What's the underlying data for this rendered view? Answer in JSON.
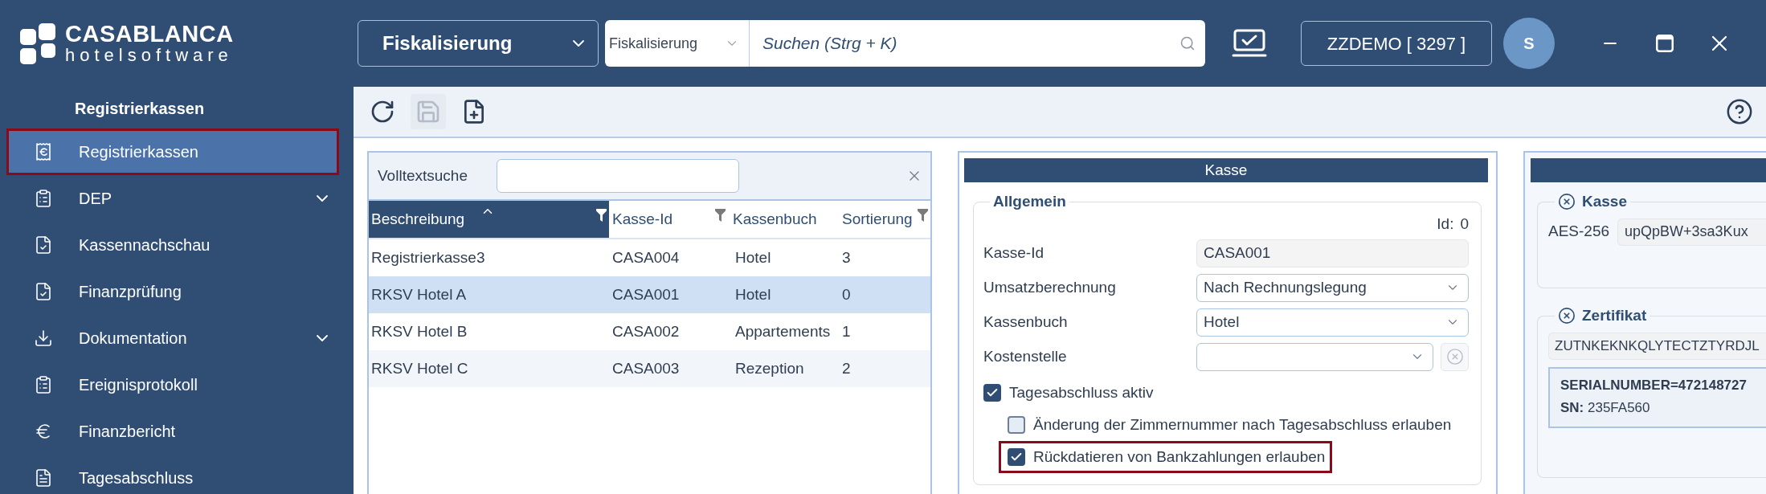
{
  "logo": {
    "name": "CASABLANCA",
    "tagline": "hotelsoftware"
  },
  "sidebar": {
    "heading": "Registrierkassen",
    "items": [
      {
        "label": "Registrierkassen",
        "selected": true,
        "highlighted": true,
        "expandable": false
      },
      {
        "label": "DEP",
        "selected": false,
        "highlighted": false,
        "expandable": true
      },
      {
        "label": "Kassennachschau",
        "selected": false,
        "highlighted": false,
        "expandable": false
      },
      {
        "label": "Finanzprüfung",
        "selected": false,
        "highlighted": false,
        "expandable": false
      },
      {
        "label": "Dokumentation",
        "selected": false,
        "highlighted": false,
        "expandable": true
      },
      {
        "label": "Ereignisprotokoll",
        "selected": false,
        "highlighted": false,
        "expandable": false
      },
      {
        "label": "Finanzbericht",
        "selected": false,
        "highlighted": false,
        "expandable": false
      },
      {
        "label": "Tagesabschluss",
        "selected": false,
        "highlighted": false,
        "expandable": false
      }
    ]
  },
  "top_bar": {
    "module": "Fiskalisierung",
    "search": {
      "scope": "Fiskalisierung",
      "placeholder": "Suchen (Strg + K)"
    },
    "client": "ZZDEMO [ 3297 ]",
    "avatar": "S"
  },
  "toolbar": {
    "buttons": [
      {
        "disabled": false
      },
      {
        "disabled": true
      },
      {
        "disabled": false
      }
    ]
  },
  "list_panel": {
    "search_label": "Volltextsuche",
    "columns": [
      {
        "label": "Beschreibung",
        "sorted": true,
        "filter": true
      },
      {
        "label": "Kasse-Id",
        "sorted": false,
        "filter": true
      },
      {
        "label": "Kassenbuch",
        "sorted": false,
        "filter": false
      },
      {
        "label": "Sortierung",
        "sorted": false,
        "filter": true
      }
    ],
    "rows": [
      {
        "cells": [
          "Registrierkasse3",
          "CASA004",
          "Hotel",
          "3"
        ],
        "selected": false
      },
      {
        "cells": [
          "RKSV Hotel A",
          "CASA001",
          "Hotel",
          "0"
        ],
        "selected": true
      },
      {
        "cells": [
          "RKSV Hotel B",
          "CASA002",
          "Appartements",
          "1"
        ],
        "selected": false
      },
      {
        "cells": [
          "RKSV Hotel C",
          "CASA003",
          "Rezeption",
          "2"
        ],
        "selected": false
      }
    ]
  },
  "detail_panel": {
    "title": "Kasse",
    "section": {
      "legend": "Allgemein",
      "id_label": "Id:",
      "id_value": "0",
      "fields": [
        {
          "kind": "text",
          "label": "Kasse-Id",
          "value": "CASA001"
        },
        {
          "kind": "select",
          "label": "Umsatzberechnung",
          "value": "Nach Rechnungslegung"
        },
        {
          "kind": "select",
          "label": "Kassenbuch",
          "value": "Hotel"
        },
        {
          "kind": "select_clear",
          "label": "Kostenstelle"
        }
      ],
      "checkboxes": [
        {
          "label": "Tagesabschluss aktiv",
          "checked": true,
          "highlighted": false,
          "children": [
            {
              "label": "Änderung der Zimmernummer nach Tagesabschluss erlauben",
              "checked": false,
              "highlighted": false
            },
            {
              "label": "Rückdatieren von Bankzahlungen erlauben",
              "checked": true,
              "highlighted": true
            }
          ]
        }
      ]
    }
  },
  "security_panel": {
    "sections": [
      {
        "kind": "key",
        "legend": "Kasse",
        "label": "AES-256",
        "value": "upQpBW+3sa3Kux"
      },
      {
        "kind": "certificate",
        "legend": "Zertifikat",
        "value": "ZUTNKEKNKQLYTECTZTYRDJL",
        "subject": "SERIALNUMBER=472148727",
        "serial": "**SN:** 235FA560"
      }
    ]
  }
}
